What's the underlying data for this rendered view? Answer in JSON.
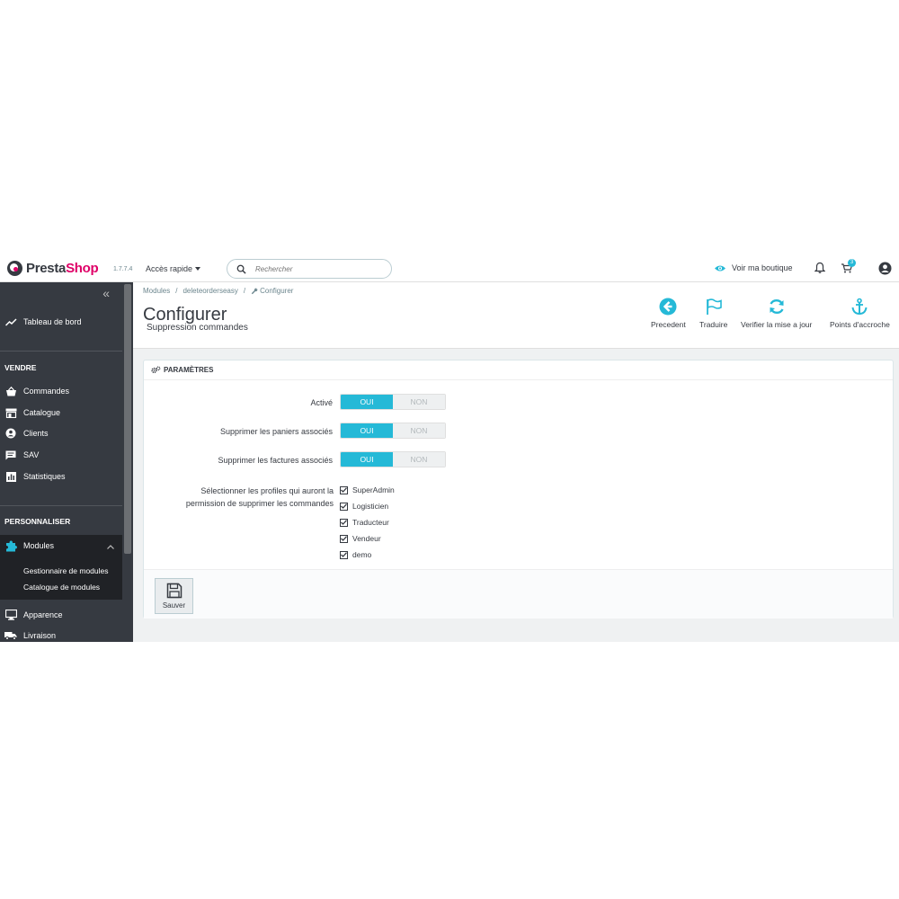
{
  "header": {
    "logo_prefix": "Presta",
    "logo_suffix": "Shop",
    "version": "1.7.7.4",
    "quick_access": "Accès rapide",
    "search_placeholder": "Rechercher",
    "view_shop": "Voir ma boutique",
    "notification_badge": "3"
  },
  "sidebar": {
    "dashboard": "Tableau de bord",
    "section_sell": "VENDRE",
    "orders": "Commandes",
    "catalog": "Catalogue",
    "customers": "Clients",
    "support": "SAV",
    "stats": "Statistiques",
    "section_customize": "PERSONNALISER",
    "modules": "Modules",
    "module_manager": "Gestionnaire de modules",
    "module_catalog": "Catalogue de modules",
    "appearance": "Apparence",
    "shipping": "Livraison"
  },
  "breadcrumb": {
    "items": [
      "Modules",
      "/",
      "deleteorderseasy",
      "/"
    ],
    "current": "Configurer"
  },
  "page": {
    "title": "Configurer",
    "subtitle": "Suppression commandes"
  },
  "toolbar": {
    "back": "Precedent",
    "translate": "Traduire",
    "check_update": "Verifier la mise a jour",
    "hooks": "Points d'accroche"
  },
  "panel": {
    "heading": "PARAMÈTRES",
    "active_label": "Activé",
    "carts_label": "Supprimer les paniers associés",
    "invoices_label": "Supprimer les factures associés",
    "yes": "OUI",
    "no": "NON",
    "active_value": "OUI",
    "carts_value": "OUI",
    "invoices_value": "OUI",
    "profiles_label": "Sélectionner les profiles qui auront la permission de supprimer les commandes",
    "profiles": [
      {
        "name": "SuperAdmin",
        "checked": true
      },
      {
        "name": "Logisticien",
        "checked": true
      },
      {
        "name": "Traducteur",
        "checked": true
      },
      {
        "name": "Vendeur",
        "checked": true
      },
      {
        "name": "demo",
        "checked": true
      }
    ],
    "save": "Sauver"
  },
  "colors": {
    "accent": "#25b9d7",
    "sidebar": "#363a41",
    "brand_pink": "#df0067"
  }
}
